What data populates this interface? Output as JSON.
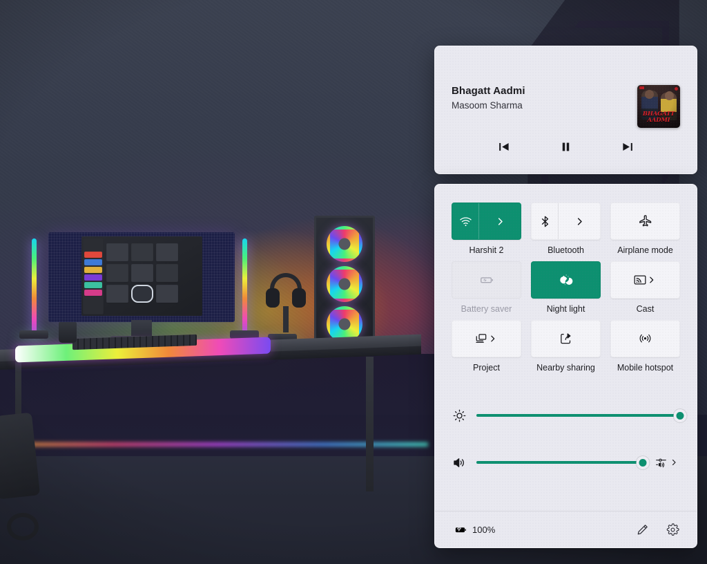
{
  "wallpaper": {
    "description": "dark gaming desk setup with RGB lighting"
  },
  "media_panel": {
    "track_title": "Bhagatt Aadmi",
    "artist": "Masoom Sharma",
    "album_art_text": "BHAGATT AADMI",
    "controls": {
      "previous_label": "Previous",
      "play_pause_label": "Pause",
      "next_label": "Next"
    }
  },
  "quick_settings": {
    "tiles": [
      {
        "label": "Harshit 2",
        "icon": "wifi-icon",
        "state": "on",
        "chevron": "split"
      },
      {
        "label": "Bluetooth",
        "icon": "bluetooth-icon",
        "state": "off",
        "chevron": "split"
      },
      {
        "label": "Airplane mode",
        "icon": "airplane-icon",
        "state": "off",
        "chevron": "none"
      },
      {
        "label": "Battery saver",
        "icon": "battery-saver-icon",
        "state": "disabled",
        "chevron": "none"
      },
      {
        "label": "Night light",
        "icon": "moon-icon",
        "state": "on",
        "chevron": "none"
      },
      {
        "label": "Cast",
        "icon": "cast-icon",
        "state": "off",
        "chevron": "inline"
      },
      {
        "label": "Project",
        "icon": "project-icon",
        "state": "off",
        "chevron": "inline"
      },
      {
        "label": "Nearby sharing",
        "icon": "nearby-sharing-icon",
        "state": "off",
        "chevron": "none"
      },
      {
        "label": "Mobile hotspot",
        "icon": "hotspot-icon",
        "state": "off",
        "chevron": "none"
      }
    ],
    "sliders": [
      {
        "name": "brightness",
        "icon": "brightness-icon",
        "value": 100
      },
      {
        "name": "volume",
        "icon": "volume-icon",
        "value": 100
      }
    ],
    "volume_mixer_label": "Select sound output",
    "footer": {
      "battery_icon": "battery-charging-icon",
      "battery_percent": "100%",
      "edit_label": "Edit quick settings",
      "settings_label": "Settings"
    }
  },
  "colors": {
    "accent": "#0d9070",
    "panel_bg": "#e9e9f0",
    "tile_bg": "#f4f4f8",
    "tile_disabled_bg": "#e8e8ee",
    "text": "#1c1c20",
    "text_dim": "#9a9aa6"
  }
}
